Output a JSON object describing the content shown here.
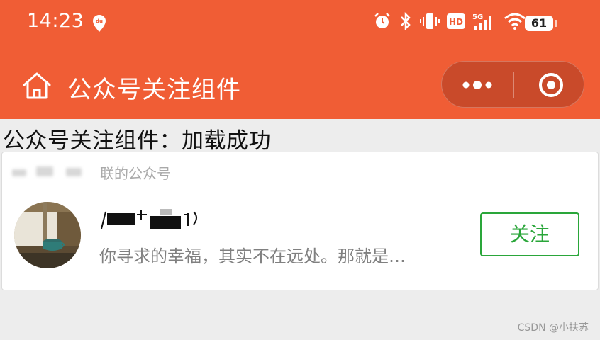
{
  "status_bar": {
    "time": "14:23",
    "battery_level": "61",
    "network_label": "5G",
    "hd_label": "HD",
    "icons": [
      "location-pin-icon",
      "alarm-icon",
      "bluetooth-icon",
      "vibrate-icon",
      "hd-icon",
      "signal-5g-icon",
      "wifi-icon",
      "battery-icon"
    ]
  },
  "nav": {
    "title": "公众号关注组件",
    "icons": [
      "home-icon",
      "more-icon",
      "close-capsule-icon"
    ]
  },
  "content": {
    "status_text": "公众号关注组件：加载成功"
  },
  "official_account_card": {
    "header_text": "联的公众号",
    "description": "你寻求的幸福，其实不在远处。那就是…",
    "follow_label": "关注"
  },
  "watermark": "CSDN @小扶苏",
  "colors": {
    "brand_orange": "#f05d35",
    "capsule": "#c94a2a",
    "follow_green": "#2aa63a",
    "background": "#ededed"
  }
}
